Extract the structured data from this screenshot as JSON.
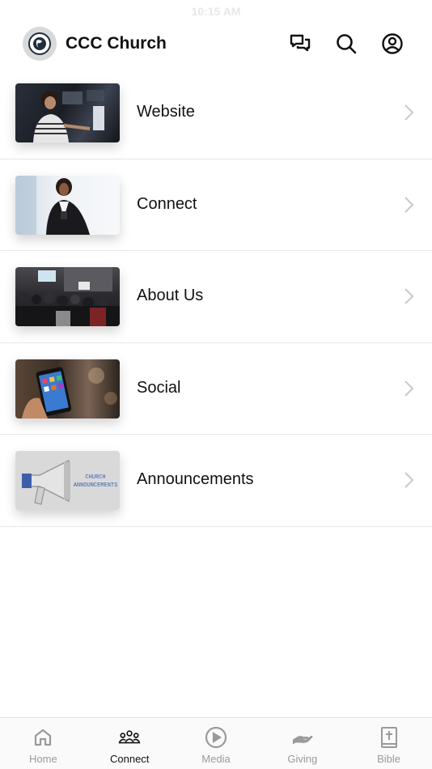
{
  "status_bar": {
    "time": "10:15 AM"
  },
  "header": {
    "title": "CCC Church",
    "icons": [
      "chat-icon",
      "search-icon",
      "profile-icon"
    ]
  },
  "list": {
    "items": [
      {
        "label": "Website",
        "thumbnail": "person-at-computer"
      },
      {
        "label": "Connect",
        "thumbnail": "woman-with-phone"
      },
      {
        "label": "About Us",
        "thumbnail": "church-congregation"
      },
      {
        "label": "Social",
        "thumbnail": "hand-holding-phone"
      },
      {
        "label": "Announcements",
        "thumbnail": "megaphone",
        "thumbnail_text": "CHURCH ANNOUNCEMENTS"
      }
    ]
  },
  "tabbar": {
    "active": "Connect",
    "tabs": [
      {
        "label": "Home",
        "icon": "home-icon"
      },
      {
        "label": "Connect",
        "icon": "people-icon"
      },
      {
        "label": "Media",
        "icon": "play-icon"
      },
      {
        "label": "Giving",
        "icon": "giving-hand-icon"
      },
      {
        "label": "Bible",
        "icon": "bible-icon"
      }
    ]
  },
  "colors": {
    "text": "#111111",
    "muted": "#9a9a9a",
    "divider": "#e6e6e6",
    "accent_blue": "#3d5fa8"
  }
}
